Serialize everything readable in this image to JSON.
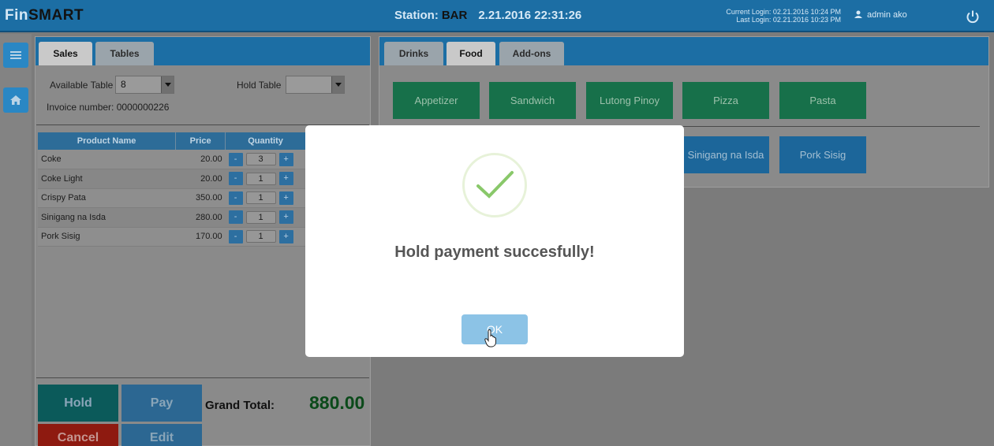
{
  "app": {
    "brand_prefix": "Fin",
    "brand_suffix": "SMART",
    "station_label": "Station:",
    "station_value": "BAR",
    "datetime": "2.21.2016 22:31:26",
    "current_login": "Current Login: 02.21.2016 10:24 PM",
    "last_login": "Last Login: 02.21.2016 10:23 PM",
    "user_name": "admin ako"
  },
  "sidebar": {
    "icons": [
      "menu-icon",
      "home-icon"
    ]
  },
  "left_panel": {
    "tabs": [
      {
        "label": "Sales"
      },
      {
        "label": "Tables"
      }
    ],
    "available_table_label": "Available Table",
    "available_table_value": "8",
    "hold_table_label": "Hold Table",
    "hold_table_value": "",
    "invoice_label": "Invoice number: 0000000226",
    "columns": [
      "Product Name",
      "Price",
      "Quantity"
    ],
    "rows": [
      {
        "name": "Coke",
        "price": "20.00",
        "qty": "3"
      },
      {
        "name": "Coke Light",
        "price": "20.00",
        "qty": "1"
      },
      {
        "name": "Crispy Pata",
        "price": "350.00",
        "qty": "1"
      },
      {
        "name": "Sinigang na Isda",
        "price": "280.00",
        "qty": "1"
      },
      {
        "name": "Pork Sisig",
        "price": "170.00",
        "qty": "1"
      }
    ],
    "minus": "-",
    "plus": "+",
    "buttons": {
      "hold": "Hold",
      "pay": "Pay",
      "cancel": "Cancel",
      "edit": "Edit"
    },
    "grand_total_label": "Grand Total:",
    "grand_total_value": "880.00"
  },
  "right_panel": {
    "tabs": [
      {
        "label": "Drinks"
      },
      {
        "label": "Food"
      },
      {
        "label": "Add-ons"
      }
    ],
    "categories": [
      "Appetizer",
      "Sandwich",
      "Lutong Pinoy",
      "Pizza",
      "Pasta"
    ],
    "items": [
      "Sinigang na Isda",
      "Pork Sisig"
    ]
  },
  "modal": {
    "message": "Hold payment succesfully!",
    "ok_label": "OK"
  },
  "colors": {
    "header_blue": "#1c6ea4",
    "category_green": "#17704a",
    "item_blue": "#1c669a",
    "hold_teal": "#0b5a5a",
    "cancel_red": "#8e1a10",
    "ok_button": "#8cc3e6"
  }
}
